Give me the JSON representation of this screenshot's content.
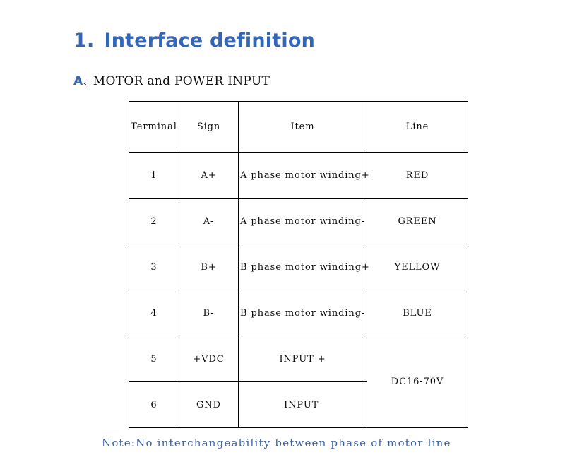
{
  "document": {
    "heading": {
      "number": "1.",
      "text": "Interface definition",
      "color": "#3366b5"
    },
    "subheading": {
      "marker": "A",
      "separator": "、",
      "text": "MOTOR and POWER INPUT",
      "marker_color": "#3366b5",
      "text_color": "#111111"
    },
    "note": {
      "text": "Note:No interchangeability between phase of motor line",
      "color": "#3a63a8"
    }
  },
  "table": {
    "headers": [
      "Terminal",
      "Sign",
      "Item",
      "Line"
    ],
    "rows": [
      {
        "terminal": "1",
        "sign": "A+",
        "item": "A phase motor winding+",
        "line": "RED"
      },
      {
        "terminal": "2",
        "sign": "A-",
        "item": "A phase motor winding-",
        "line": "GREEN"
      },
      {
        "terminal": "3",
        "sign": "B+",
        "item": "B phase motor winding+",
        "line": "YELLOW"
      },
      {
        "terminal": "4",
        "sign": "B-",
        "item": "B phase motor winding-",
        "line": "BLUE"
      },
      {
        "terminal": "5",
        "sign": "+VDC",
        "item": "INPUT +",
        "line": "DC16-70V"
      },
      {
        "terminal": "6",
        "sign": "GND",
        "item": "INPUT-",
        "line": ""
      }
    ],
    "merged_line_value": "DC16-70V",
    "border_color": "#000000"
  }
}
